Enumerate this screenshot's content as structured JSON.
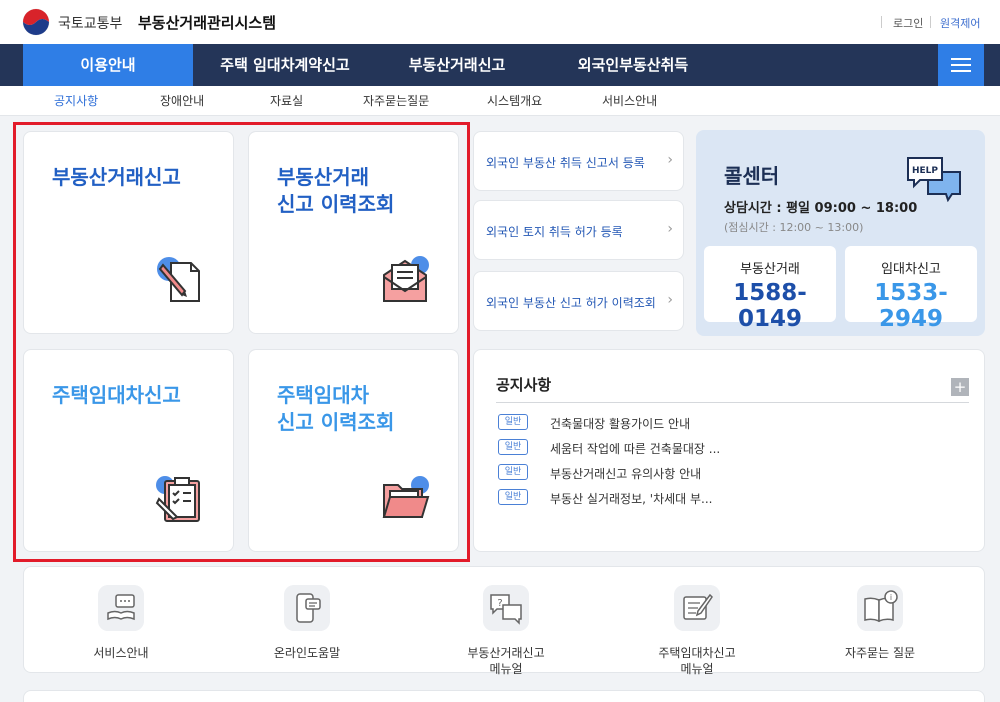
{
  "header": {
    "org": "국토교통부",
    "system_name": "부동산거래관리시스템",
    "login": "로그인",
    "remote": "원격제어"
  },
  "main_nav": [
    {
      "label": "이용안내",
      "active": true
    },
    {
      "label": "주택 임대차계약신고"
    },
    {
      "label": "부동산거래신고"
    },
    {
      "label": "외국인부동산취득"
    }
  ],
  "sub_nav": [
    {
      "label": "공지사항",
      "active": true
    },
    {
      "label": "장애안내"
    },
    {
      "label": "자료실"
    },
    {
      "label": "자주묻는질문"
    },
    {
      "label": "시스템개요"
    },
    {
      "label": "서비스안내"
    }
  ],
  "cards": [
    {
      "title": "부동산거래신고",
      "icon": "pencil-document-icon"
    },
    {
      "title": "부동산거래\n신고 이력조회",
      "icon": "envelope-icon"
    },
    {
      "title": "주택임대차신고",
      "icon": "clipboard-icon"
    },
    {
      "title": "주택임대차\n신고 이력조회",
      "icon": "folder-icon"
    }
  ],
  "links": [
    {
      "label": "외국인 부동산 취득 신고서 등록"
    },
    {
      "label": "외국인 토지 취득 허가 등록"
    },
    {
      "label": "외국인 부동산 신고 허가 이력조회"
    }
  ],
  "call_center": {
    "title": "콜센터",
    "hours": "상담시간 : 평일 09:00 ~ 18:00",
    "break": "(점심시간 : 12:00 ~ 13:00)",
    "help_text": "HELP",
    "numbers": [
      {
        "label": "부동산거래",
        "number": "1588-0149"
      },
      {
        "label": "임대차신고",
        "number": "1533-2949"
      }
    ]
  },
  "notice": {
    "title": "공지사항",
    "plus": "+",
    "items": [
      {
        "badge": "일반",
        "text": "건축물대장 활용가이드 안내"
      },
      {
        "badge": "일반",
        "text": "세움터 작업에 따른 건축물대장 ..."
      },
      {
        "badge": "일반",
        "text": "부동산거래신고 유의사항 안내"
      },
      {
        "badge": "일반",
        "text": "부동산 실거래정보, '차세대 부..."
      }
    ]
  },
  "shortcuts": [
    {
      "label": "서비스안내",
      "icon": "book-chat-icon"
    },
    {
      "label": "온라인도움말",
      "icon": "mobile-help-icon"
    },
    {
      "label": "부동산거래신고\n메뉴얼",
      "icon": "question-chat-icon"
    },
    {
      "label": "주택임대차신고\n메뉴얼",
      "icon": "memo-pen-icon"
    },
    {
      "label": "자주묻는 질문",
      "icon": "info-book-icon"
    }
  ],
  "colors": {
    "nav_bg": "#243558",
    "accent": "#2f7ee6",
    "highlight": "#e21b2a"
  }
}
